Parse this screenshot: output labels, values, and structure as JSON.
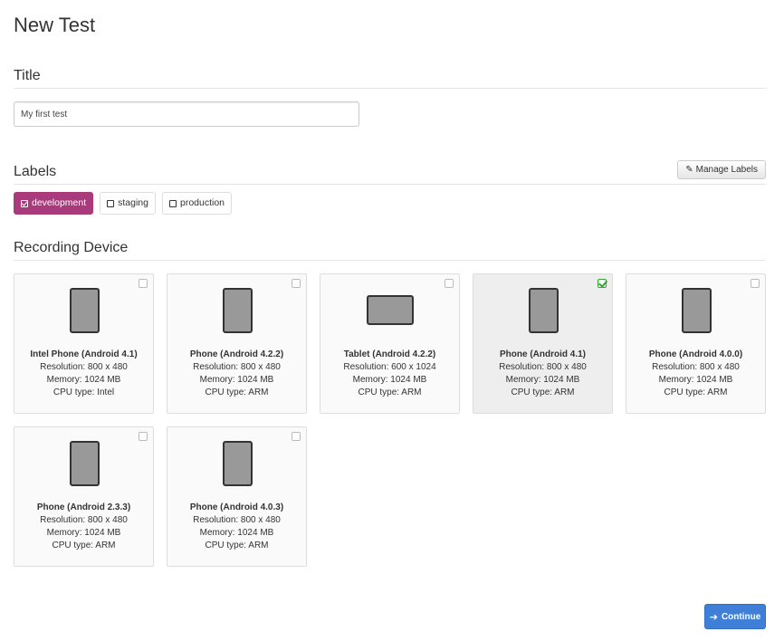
{
  "page": {
    "title": "New Test"
  },
  "title_section": {
    "heading": "Title",
    "input_value": "My first test"
  },
  "labels_section": {
    "heading": "Labels",
    "manage_label": "Manage Labels",
    "labels": [
      {
        "label": "development",
        "checked": true
      },
      {
        "label": "staging",
        "checked": false
      },
      {
        "label": "production",
        "checked": false
      }
    ]
  },
  "device_section": {
    "heading": "Recording Device",
    "devices": [
      {
        "name": "Intel Phone (Android 4.1)",
        "resolution": "Resolution: 800 x 480",
        "memory": "Memory: 1024 MB",
        "cpu": "CPU type: Intel",
        "form": "phone",
        "selected": false
      },
      {
        "name": "Phone (Android 4.2.2)",
        "resolution": "Resolution: 800 x 480",
        "memory": "Memory: 1024 MB",
        "cpu": "CPU type: ARM",
        "form": "phone",
        "selected": false
      },
      {
        "name": "Tablet (Android 4.2.2)",
        "resolution": "Resolution: 600 x 1024",
        "memory": "Memory: 1024 MB",
        "cpu": "CPU type: ARM",
        "form": "tablet",
        "selected": false
      },
      {
        "name": "Phone (Android 4.1)",
        "resolution": "Resolution: 800 x 480",
        "memory": "Memory: 1024 MB",
        "cpu": "CPU type: ARM",
        "form": "phone",
        "selected": true
      },
      {
        "name": "Phone (Android 4.0.0)",
        "resolution": "Resolution: 800 x 480",
        "memory": "Memory: 1024 MB",
        "cpu": "CPU type: ARM",
        "form": "phone",
        "selected": false
      },
      {
        "name": "Phone (Android 2.3.3)",
        "resolution": "Resolution: 800 x 480",
        "memory": "Memory: 1024 MB",
        "cpu": "CPU type: ARM",
        "form": "phone",
        "selected": false
      },
      {
        "name": "Phone (Android 4.0.3)",
        "resolution": "Resolution: 800 x 480",
        "memory": "Memory: 1024 MB",
        "cpu": "CPU type: ARM",
        "form": "phone",
        "selected": false
      }
    ]
  },
  "actions": {
    "continue_label": "Continue"
  },
  "icons": {
    "manage": "pencil-icon",
    "continue": "arrow-right-icon",
    "device_phone": "phone-icon",
    "device_tablet": "tablet-icon"
  },
  "colors": {
    "label_active": "#a93a7c",
    "continue_button": "#3f7fd7",
    "check_selected": "#2ca92c"
  }
}
